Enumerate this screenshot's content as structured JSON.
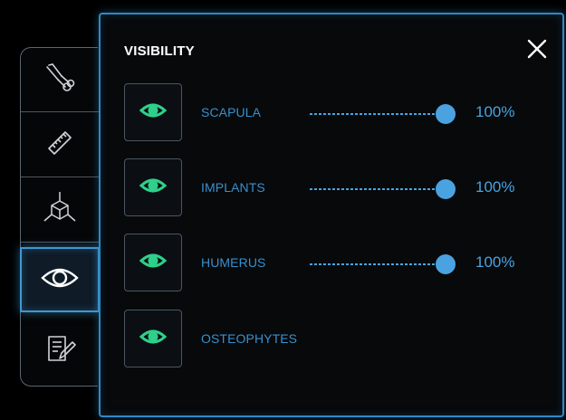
{
  "panel": {
    "title": "VISIBILITY",
    "close_icon": "close-icon"
  },
  "sidebar": {
    "items": [
      {
        "name": "clamp-tool-icon",
        "active": false
      },
      {
        "name": "ruler-icon",
        "active": false
      },
      {
        "name": "axis-cube-icon",
        "active": false
      },
      {
        "name": "eye-icon",
        "active": true
      },
      {
        "name": "notes-edit-icon",
        "active": false
      }
    ]
  },
  "layers": [
    {
      "label": "SCAPULA",
      "value": "100%",
      "level": 1.0,
      "has_slider": true
    },
    {
      "label": "IMPLANTS",
      "value": "100%",
      "level": 1.0,
      "has_slider": true
    },
    {
      "label": "HUMERUS",
      "value": "100%",
      "level": 1.0,
      "has_slider": true
    },
    {
      "label": "OSTEOPHYTES",
      "value": null,
      "level": null,
      "has_slider": false
    }
  ],
  "colors": {
    "accent_blue": "#3e98d2",
    "eye_green": "#2fd08a",
    "label_blue": "#3a8fcc",
    "title_white": "#ffffff"
  }
}
